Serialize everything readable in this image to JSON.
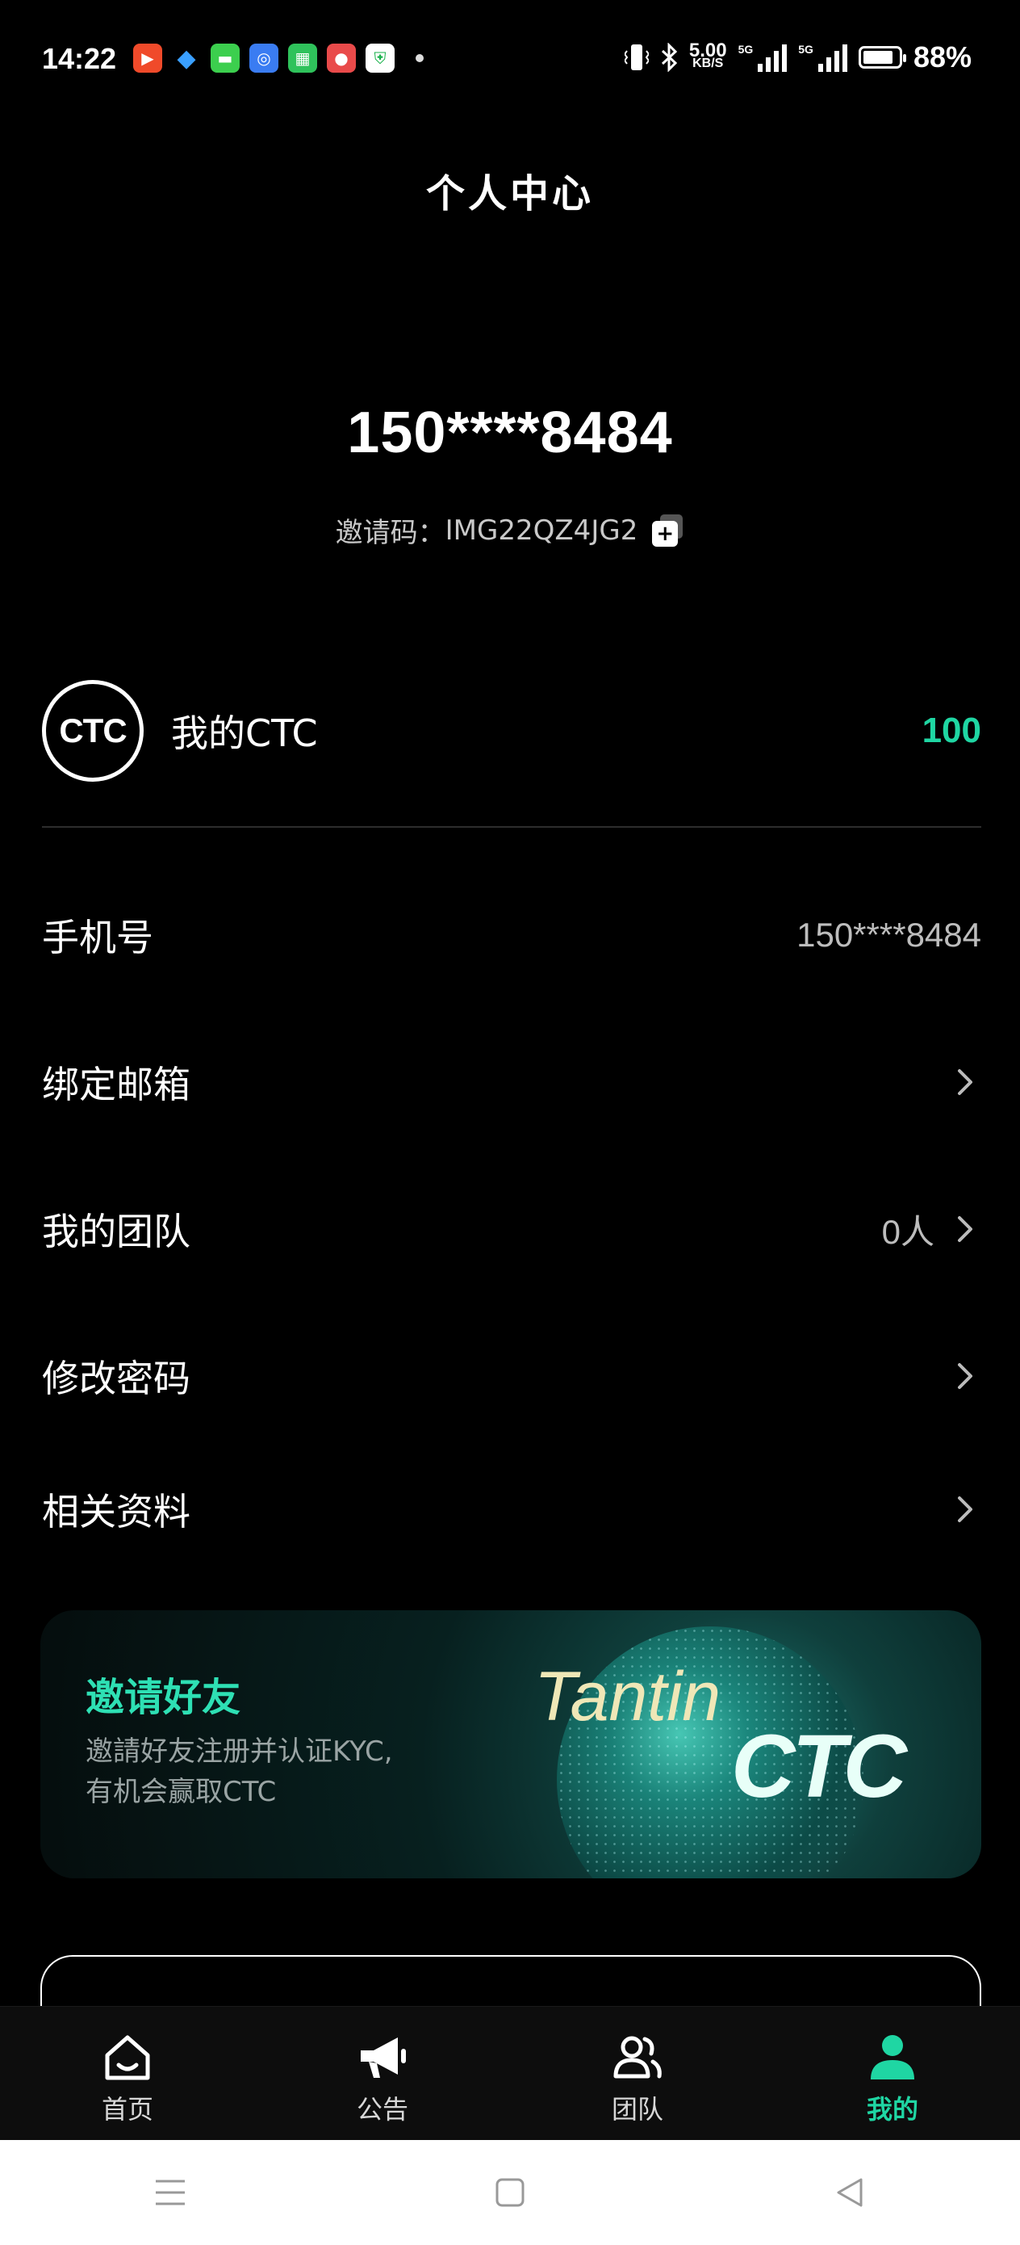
{
  "status_bar": {
    "time": "14:22",
    "app_icons": [
      "video-app-icon",
      "qq-icon",
      "message-app-icon",
      "browser-app-icon",
      "store-app-icon",
      "pet-app-icon",
      "shield-app-icon"
    ],
    "speed_value": "5.00",
    "speed_unit": "KB/S",
    "signal1_tag": "5G",
    "signal2_tag": "5G",
    "battery_pct": "88%",
    "battery_level": 0.88
  },
  "page": {
    "title": "个人中心"
  },
  "profile": {
    "phone": "150****8484",
    "invite_label": "邀请码：",
    "invite_code": "IMG22QZ4JG2"
  },
  "ctc": {
    "logo_text": "CTC",
    "label": "我的CTC",
    "value": "100"
  },
  "menu": {
    "phone_label": "手机号",
    "phone_value": "150****8484",
    "email_label": "绑定邮箱",
    "team_label": "我的团队",
    "team_value": "0人",
    "password_label": "修改密码",
    "docs_label": "相关资料"
  },
  "banner": {
    "title": "邀请好友",
    "subtitle_line1": "邀請好友注册并认证KYC,",
    "subtitle_line2": "有机会赢取CTC",
    "brand_line1": "Tantin",
    "brand_line2": "CTC"
  },
  "tabs": [
    {
      "label": "首页",
      "icon": "home-icon",
      "active": false
    },
    {
      "label": "公告",
      "icon": "megaphone-icon",
      "active": false
    },
    {
      "label": "团队",
      "icon": "team-icon",
      "active": false
    },
    {
      "label": "我的",
      "icon": "profile-icon",
      "active": true
    }
  ],
  "colors": {
    "accent": "#1fd6a3",
    "background": "#000000"
  }
}
